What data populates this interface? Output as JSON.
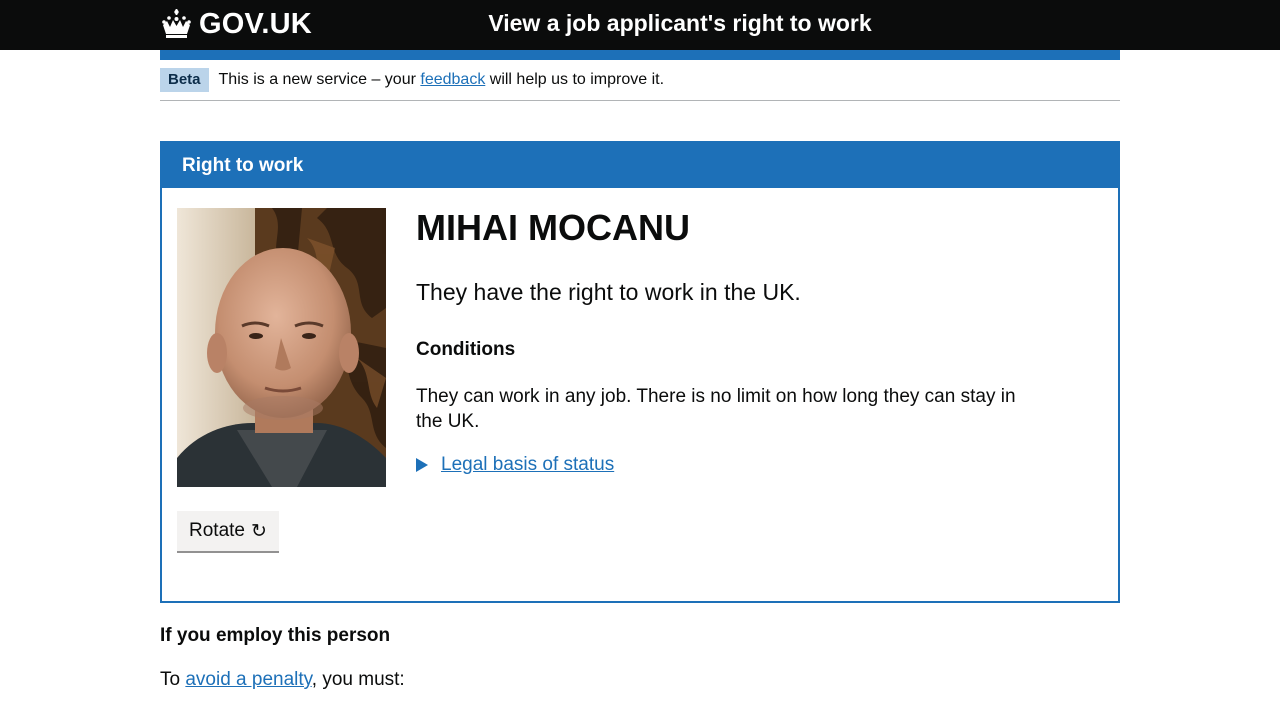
{
  "header": {
    "logo_text": "GOV.UK",
    "service_name": "View a job applicant's right to work"
  },
  "phase_banner": {
    "tag": "Beta",
    "text_before": "This is a new service – your ",
    "link_text": "feedback",
    "text_after": " will help us to improve it."
  },
  "card": {
    "title": "Right to work",
    "person_name": "MIHAI MOCANU",
    "status": "They have the right to work in the UK.",
    "conditions_heading": "Conditions",
    "conditions_text": "They can work in any job. There is no limit on how long they can stay in the UK.",
    "details_summary": "Legal basis of status",
    "rotate_label": "Rotate",
    "rotate_icon": "↻"
  },
  "employ": {
    "heading": "If you employ this person",
    "para_before": "To ",
    "para_link": "avoid a penalty",
    "para_after": ", you must:"
  },
  "colors": {
    "header_bg": "#0b0c0c",
    "brand_blue": "#1d70b8",
    "tag_bg": "#bbd4ea",
    "button_bg": "#f3f2f1"
  }
}
